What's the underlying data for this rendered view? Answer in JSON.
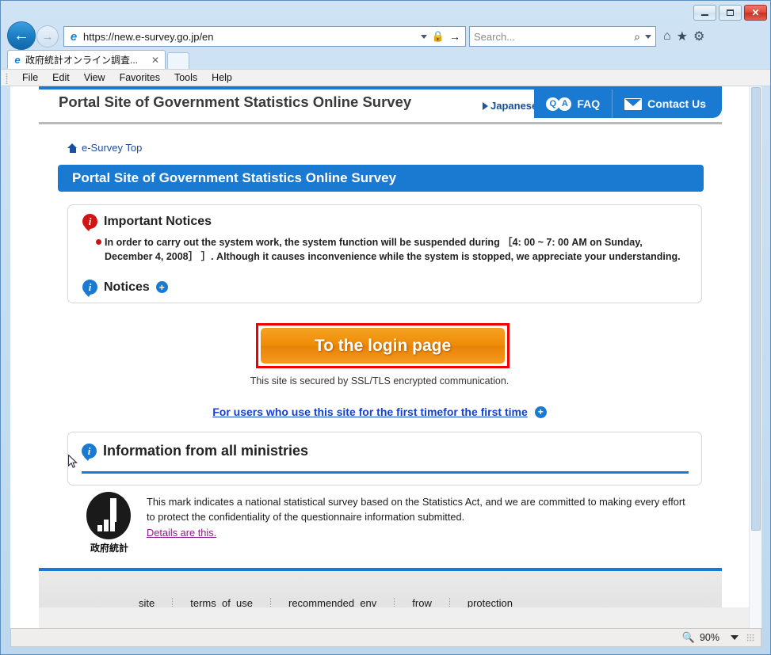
{
  "browser": {
    "window_buttons": {
      "minimize": "—",
      "maximize": "□",
      "close": "✕"
    },
    "back_glyph": "←",
    "forward_glyph": "→",
    "url": "https://new.e-survey.go.jp/en",
    "url_caret": "▾",
    "lock_icon": "🔒",
    "go_icon": "→",
    "search_placeholder": "Search...",
    "search_icon": "⌕",
    "home_icon": "⌂",
    "favorites_icon": "★",
    "settings_icon": "⚙",
    "tab_title": "政府統計オンライン調査...",
    "tab_close": "✕",
    "menu_items": [
      "File",
      "Edit",
      "View",
      "Favorites",
      "Tools",
      "Help"
    ]
  },
  "status_bar": {
    "zoom_level": "90%"
  },
  "site": {
    "title": "Portal Site of Government Statistics Online Survey",
    "japanese_link": "Japanese",
    "faq_label": "FAQ",
    "faq_icon_q": "Q",
    "faq_icon_a": "A",
    "contact_label": "Contact Us",
    "breadcrumb": "e-Survey Top",
    "page_banner": "Portal Site of Government Statistics Online Survey"
  },
  "important_notices": {
    "heading": "Important Notices",
    "badge_letter": "i",
    "body": "In order to carry out the system work, the system function will be suspended during ［4: 00 ~ 7: 00 AM on Sunday, December 4, 2008］ ］. Although it causes inconvenience while the system is stopped, we appreciate your understanding.",
    "notices_label": "Notices",
    "expand_icon": "+"
  },
  "login": {
    "button_label": "To the login page",
    "ssl_note": "This site is secured by SSL/TLS encrypted communication."
  },
  "first_time": {
    "link_text": "For users who use this site for the first timefor the first time",
    "expand_icon": "+"
  },
  "ministries": {
    "heading": "Information from all ministries",
    "badge_letter": "i"
  },
  "mark": {
    "caption": "政府統計",
    "text": "This mark indicates a national statistical survey based on the Statistics Act, and we are committed to making every effort to protect the confidentiality of the questionnaire information submitted.",
    "details_link": "Details are this."
  },
  "footer": {
    "items": [
      "site",
      "terms_of_use",
      "recommended_env",
      "frow",
      "protection"
    ]
  },
  "colors": {
    "brand_blue": "#1a7ad2",
    "login_orange": "#ef8c08",
    "alert_red": "#ee0000",
    "link_blue": "#1144cc",
    "details_purple": "#8c1a8c"
  }
}
